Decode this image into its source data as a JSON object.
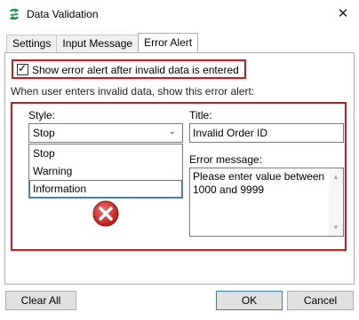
{
  "window": {
    "title": "Data Validation",
    "close_glyph": "✕",
    "app_icon": "app-logo-icon"
  },
  "tabs": [
    {
      "label": "Settings",
      "active": false
    },
    {
      "label": "Input Message",
      "active": false
    },
    {
      "label": "Error Alert",
      "active": true
    }
  ],
  "error_alert": {
    "show_alert_label": "Show error alert after invalid data is entered",
    "show_alert_checked": true,
    "section_label": "When user enters invalid data, show this error alert:",
    "style_label": "Style:",
    "style_selected": "Stop",
    "style_options": [
      "Stop",
      "Warning",
      "Information"
    ],
    "title_label": "Title:",
    "title_value": "Invalid Order ID",
    "message_label": "Error message:",
    "message_value": "Please enter value between 1000 and 9999",
    "style_icon": "error-stop-icon"
  },
  "buttons": {
    "clear_all": "Clear All",
    "ok": "OK",
    "cancel": "Cancel"
  },
  "colors": {
    "highlight_border": "#cc1a1a",
    "error_icon": "#cc1f1f",
    "focus_border": "#3a78c8",
    "app_icon": "#1b9a4b"
  }
}
